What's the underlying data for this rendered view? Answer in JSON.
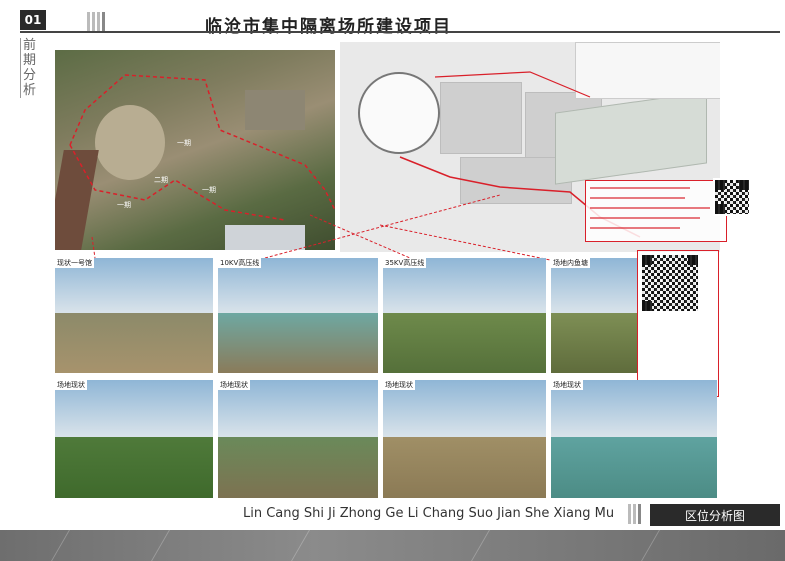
{
  "header": {
    "page_number": "01",
    "title": "临沧市集中隔离场所建设项目",
    "side_label": "前期分析"
  },
  "aerial": {
    "labels": [
      "一期",
      "二期",
      "一期",
      "一期"
    ]
  },
  "photos": [
    {
      "caption": "现状一号馆"
    },
    {
      "caption": "10KV高压线"
    },
    {
      "caption": "35KV高压线"
    },
    {
      "caption": "场地内鱼塘"
    },
    {
      "caption": "场地现状"
    },
    {
      "caption": "场地现状"
    },
    {
      "caption": "场地现状"
    },
    {
      "caption": "场地现状"
    }
  ],
  "footer": {
    "pinyin": "Lin Cang Shi Ji Zhong Ge Li Chang Suo Jian She Xiang Mu",
    "section": "区位分析图"
  },
  "colors": {
    "accent_red": "#d9202a",
    "header_dark": "#2a2a2a"
  }
}
